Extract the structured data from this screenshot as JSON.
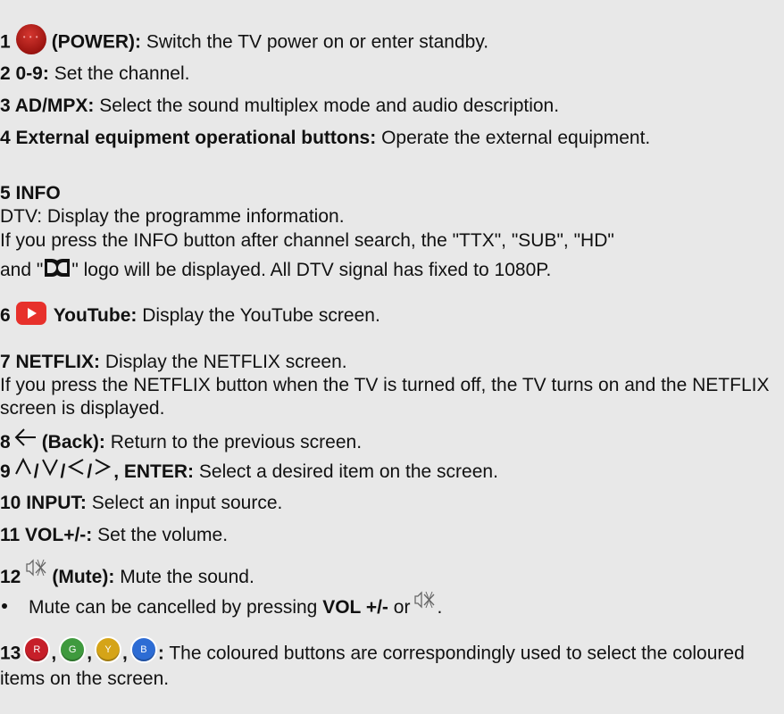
{
  "items": [
    {
      "num": "1",
      "bold": "(POWER):",
      "text": "Switch the TV power on or enter standby.",
      "icon": "power-button-red-icon"
    },
    {
      "num": "2 0-9:",
      "text": "Set the channel."
    },
    {
      "num": "3 AD/MPX:",
      "text": "Select the sound multiplex mode and audio description."
    },
    {
      "num": "4 External equipment operational buttons:",
      "text": "Operate the external equipment."
    },
    {
      "num": "5 INFO",
      "lines": [
        "DTV: Display the programme information.",
        "If you press the INFO button after channel search, the \"TTX\", \"SUB\", \"HD\"",
        "and \"",
        "\" logo will be displayed. All DTV signal has fixed to 1080P."
      ],
      "icon": "dolby-logo-icon"
    },
    {
      "num": "6",
      "bold": "YouTube:",
      "text": "Display the YouTube screen.",
      "icon": "youtube-button-icon"
    },
    {
      "num": "7 NETFLIX:",
      "text": "Display the NETFLIX screen.",
      "extra": "If you press the NETFLIX button when the TV is turned off, the TV turns on and the NETFLIX screen is displayed."
    },
    {
      "num": "8",
      "bold": "(Back):",
      "text": "Return to the previous screen.",
      "icon": "back-arrow-icon"
    },
    {
      "num": "9",
      "sep": "/",
      "bold": ", ENTER:",
      "text": "Select a desired item on the screen.",
      "icons": [
        "up-arrow-icon",
        "down-arrow-icon",
        "left-arrow-icon",
        "right-arrow-icon"
      ]
    },
    {
      "num": "10 INPUT:",
      "text": "Select an input source."
    },
    {
      "num": "11 VOL+/-:",
      "text": "Set the volume."
    },
    {
      "num": "12",
      "bold": "(Mute):",
      "text": "Mute the sound.",
      "icon": "mute-icon",
      "bullet_pre": "Mute can be cancelled by pressing",
      "bullet_bold": "VOL +/-",
      "bullet_post": "or"
    },
    {
      "num": "13",
      "comma": ",",
      "colon": ":",
      "text": "The coloured buttons are correspondingly used to select the coloured items on the screen.",
      "buttons": [
        {
          "letter": "R",
          "color": "#c61f29"
        },
        {
          "letter": "G",
          "color": "#3f9a3e"
        },
        {
          "letter": "Y",
          "color": "#d5a418"
        },
        {
          "letter": "B",
          "color": "#2d6cd4"
        }
      ]
    }
  ]
}
